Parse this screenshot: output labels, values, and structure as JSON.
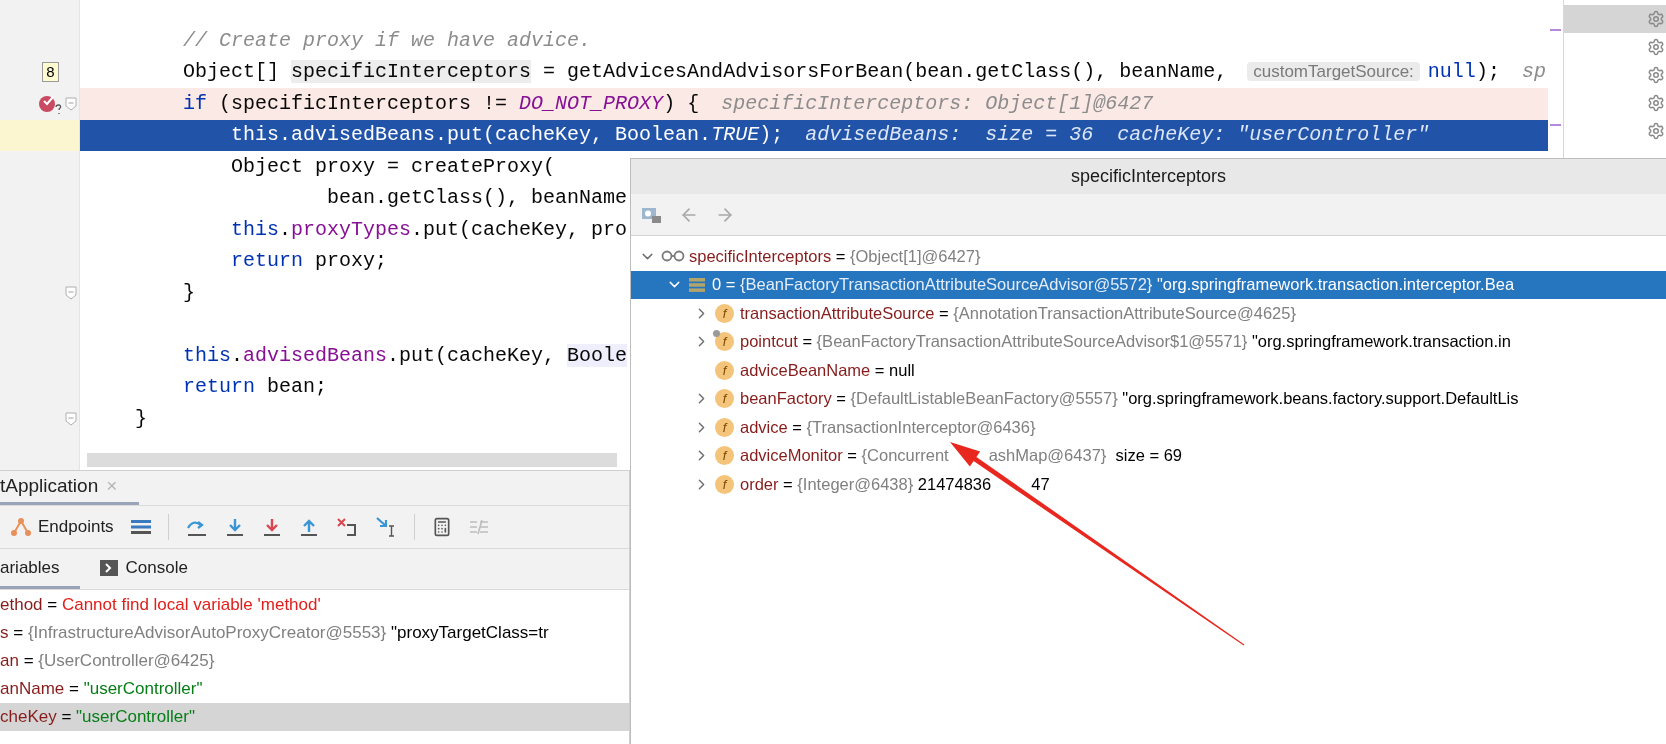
{
  "editor": {
    "lines": [
      {
        "selected": false,
        "breakpoint": false,
        "fold": false,
        "segments": [
          {
            "kind": "comment",
            "text": "        // Create proxy if we have advice."
          }
        ]
      },
      {
        "selected": false,
        "breakpoint": false,
        "fold": false,
        "badge": "8",
        "segments": [
          {
            "kind": "plain",
            "text": "        Object[] "
          },
          {
            "kind": "highlight",
            "text": "specificInterceptors"
          },
          {
            "kind": "plain",
            "text": " = getAdvicesAndAdvisorsForBean(bean.getClass(), beanName, "
          },
          {
            "kind": "param",
            "text": "customTargetSource:"
          },
          {
            "kind": "keyword",
            "text": "null"
          },
          {
            "kind": "plain",
            "text": ");"
          },
          {
            "kind": "hint",
            "text": "sp"
          }
        ]
      },
      {
        "selected": false,
        "breakpoint": true,
        "fold": true,
        "segments": [
          {
            "kind": "keyword",
            "text": "        if"
          },
          {
            "kind": "plain",
            "text": " (specificInterceptors != "
          },
          {
            "kind": "constant",
            "text": "DO_NOT_PROXY"
          },
          {
            "kind": "plain",
            "text": ") {"
          },
          {
            "kind": "hint",
            "text": "specificInterceptors: Object[1]@6427"
          }
        ]
      },
      {
        "selected": true,
        "breakpoint": false,
        "fold": false,
        "segments": [
          {
            "kind": "keyword",
            "text": "            this"
          },
          {
            "kind": "plain",
            "text": "."
          },
          {
            "kind": "field",
            "text": "advisedBeans"
          },
          {
            "kind": "plain",
            "text": ".put(cacheKey, Boolean."
          },
          {
            "kind": "italic",
            "text": "TRUE"
          },
          {
            "kind": "plain",
            "text": ");"
          },
          {
            "kind": "hint",
            "text": "advisedBeans:  size = 36  cacheKey: \"userController\""
          }
        ]
      },
      {
        "selected": false,
        "breakpoint": false,
        "fold": false,
        "segments": [
          {
            "kind": "plain",
            "text": "            Object proxy = createProxy("
          }
        ]
      },
      {
        "selected": false,
        "breakpoint": false,
        "fold": false,
        "segments": [
          {
            "kind": "plain",
            "text": "                    bean.getClass(), beanName"
          }
        ]
      },
      {
        "selected": false,
        "breakpoint": false,
        "fold": false,
        "segments": [
          {
            "kind": "keyword",
            "text": "            this"
          },
          {
            "kind": "plain",
            "text": "."
          },
          {
            "kind": "field",
            "text": "proxyTypes"
          },
          {
            "kind": "plain",
            "text": ".put(cacheKey, pro"
          }
        ]
      },
      {
        "selected": false,
        "breakpoint": false,
        "fold": false,
        "segments": [
          {
            "kind": "keyword",
            "text": "            return"
          },
          {
            "kind": "plain",
            "text": " proxy;"
          }
        ]
      },
      {
        "selected": false,
        "breakpoint": false,
        "fold": true,
        "segments": [
          {
            "kind": "plain",
            "text": "        }"
          }
        ]
      },
      {
        "selected": false,
        "breakpoint": false,
        "fold": false
      },
      {
        "selected": false,
        "breakpoint": false,
        "fold": false,
        "segments": [
          {
            "kind": "keyword",
            "text": "        this"
          },
          {
            "kind": "plain",
            "text": "."
          },
          {
            "kind": "field",
            "text": "advisedBeans"
          },
          {
            "kind": "plain",
            "text": ".put(cacheKey, "
          },
          {
            "kind": "highlight2",
            "text": "Boole"
          }
        ]
      },
      {
        "selected": false,
        "breakpoint": false,
        "fold": false,
        "segments": [
          {
            "kind": "keyword",
            "text": "        return"
          },
          {
            "kind": "plain",
            "text": " bean;"
          }
        ]
      },
      {
        "selected": false,
        "breakpoint": false,
        "fold": true,
        "segments": [
          {
            "kind": "plain",
            "text": "    }"
          }
        ]
      }
    ]
  },
  "side_panel": {
    "rows": [
      {
        "selected": true
      },
      {
        "selected": false
      },
      {
        "selected": false
      },
      {
        "selected": false
      },
      {
        "selected": false
      }
    ]
  },
  "popup": {
    "title": "specificInterceptors",
    "tree": [
      {
        "kind": "watch",
        "has_children": true,
        "expanded": true,
        "selected": false,
        "segments": [
          {
            "kind": "name",
            "text": "specificInterceptors"
          },
          {
            "kind": "plain",
            "text": " = "
          },
          {
            "kind": "object",
            "text": "{Object[1]@6427}"
          }
        ],
        "children": [
          {
            "kind": "array",
            "has_children": true,
            "expanded": true,
            "selected": true,
            "segments": [
              {
                "kind": "plain",
                "text": "0 = "
              },
              {
                "kind": "object",
                "text": "{BeanFactoryTransactionAttributeSourceAdvisor@5572}"
              },
              {
                "kind": "plain",
                "text": " \"org.springframework.transaction.interceptor.Bea"
              }
            ],
            "children": [
              {
                "kind": "field",
                "icon_text": "f",
                "marked": false,
                "has_children": true,
                "expanded": false,
                "selected": false,
                "segments": [
                  {
                    "kind": "name",
                    "text": "transactionAttributeSource"
                  },
                  {
                    "kind": "plain",
                    "text": " = "
                  },
                  {
                    "kind": "object",
                    "text": "{AnnotationTransactionAttributeSource@4625}"
                  }
                ]
              },
              {
                "kind": "field",
                "icon_text": "f",
                "marked": true,
                "has_children": true,
                "expanded": false,
                "selected": false,
                "segments": [
                  {
                    "kind": "name",
                    "text": "pointcut"
                  },
                  {
                    "kind": "plain",
                    "text": " = "
                  },
                  {
                    "kind": "object",
                    "text": "{BeanFactoryTransactionAttributeSourceAdvisor$1@5571}"
                  },
                  {
                    "kind": "plain",
                    "text": " \"org.springframework.transaction.in"
                  }
                ]
              },
              {
                "kind": "field",
                "icon_text": "f",
                "marked": false,
                "has_children": false,
                "selected": false,
                "segments": [
                  {
                    "kind": "name",
                    "text": "adviceBeanName"
                  },
                  {
                    "kind": "plain",
                    "text": " = null"
                  }
                ]
              },
              {
                "kind": "field",
                "icon_text": "f",
                "marked": false,
                "has_children": true,
                "expanded": false,
                "selected": false,
                "segments": [
                  {
                    "kind": "name",
                    "text": "beanFactory"
                  },
                  {
                    "kind": "plain",
                    "text": " = "
                  },
                  {
                    "kind": "object",
                    "text": "{DefaultListableBeanFactory@5557}"
                  },
                  {
                    "kind": "plain",
                    "text": " \"org.springframework.beans.factory.support.DefaultLis"
                  }
                ]
              },
              {
                "kind": "field",
                "icon_text": "f",
                "marked": false,
                "has_children": true,
                "expanded": false,
                "selected": false,
                "segments": [
                  {
                    "kind": "name",
                    "text": "advice"
                  },
                  {
                    "kind": "plain",
                    "text": " = "
                  },
                  {
                    "kind": "object",
                    "text": "{TransactionInterceptor@6436}"
                  }
                ]
              },
              {
                "kind": "field",
                "icon_text": "f",
                "marked": false,
                "has_children": true,
                "expanded": false,
                "selected": false,
                "segments": [
                  {
                    "kind": "name",
                    "text": "adviceMonitor"
                  },
                  {
                    "kind": "plain",
                    "text": " = "
                  },
                  {
                    "kind": "covered-object",
                    "text": "{Concurrent"
                  },
                  {
                    "kind": "object",
                    "text": "ashMap@6437}"
                  },
                  {
                    "kind": "plain",
                    "text": "  size = 69"
                  }
                ]
              },
              {
                "kind": "field",
                "icon_text": "f",
                "marked": false,
                "has_children": true,
                "expanded": false,
                "selected": false,
                "segments": [
                  {
                    "kind": "name",
                    "text": "order"
                  },
                  {
                    "kind": "plain",
                    "text": " = "
                  },
                  {
                    "kind": "object",
                    "text": "{Integer@6438}"
                  },
                  {
                    "kind": "covered-plain",
                    "text": " 21474836"
                  },
                  {
                    "kind": "plain",
                    "text": "47"
                  }
                ]
              }
            ]
          }
        ]
      }
    ]
  },
  "debug_panel": {
    "tab": {
      "label": "tApplication",
      "close": "×"
    },
    "toolbar": {
      "endpoints": "Endpoints"
    },
    "subtabs": [
      {
        "label": "ariables",
        "selected": true
      },
      {
        "label": "Console",
        "selected": false
      }
    ],
    "variables": [
      {
        "selected": false,
        "segments": [
          {
            "kind": "name",
            "text": "ethod"
          },
          {
            "kind": "plain",
            "text": " = "
          },
          {
            "kind": "error",
            "text": "Cannot find local variable 'method'"
          }
        ]
      },
      {
        "selected": false,
        "segments": [
          {
            "kind": "name",
            "text": "s"
          },
          {
            "kind": "plain",
            "text": " = "
          },
          {
            "kind": "object",
            "text": "{InfrastructureAdvisorAutoProxyCreator@5553}"
          },
          {
            "kind": "plain",
            "text": " \"proxyTargetClass=tr"
          }
        ]
      },
      {
        "selected": false,
        "segments": [
          {
            "kind": "name",
            "text": "an"
          },
          {
            "kind": "plain",
            "text": " = "
          },
          {
            "kind": "object",
            "text": "{UserController@6425}"
          }
        ]
      },
      {
        "selected": false,
        "segments": [
          {
            "kind": "name",
            "text": "anName"
          },
          {
            "kind": "plain",
            "text": " = "
          },
          {
            "kind": "string",
            "text": "\"userController\""
          }
        ]
      },
      {
        "selected": true,
        "segments": [
          {
            "kind": "name",
            "text": "cheKey"
          },
          {
            "kind": "plain",
            "text": " = "
          },
          {
            "kind": "string",
            "text": "\"userController\""
          }
        ]
      }
    ]
  }
}
